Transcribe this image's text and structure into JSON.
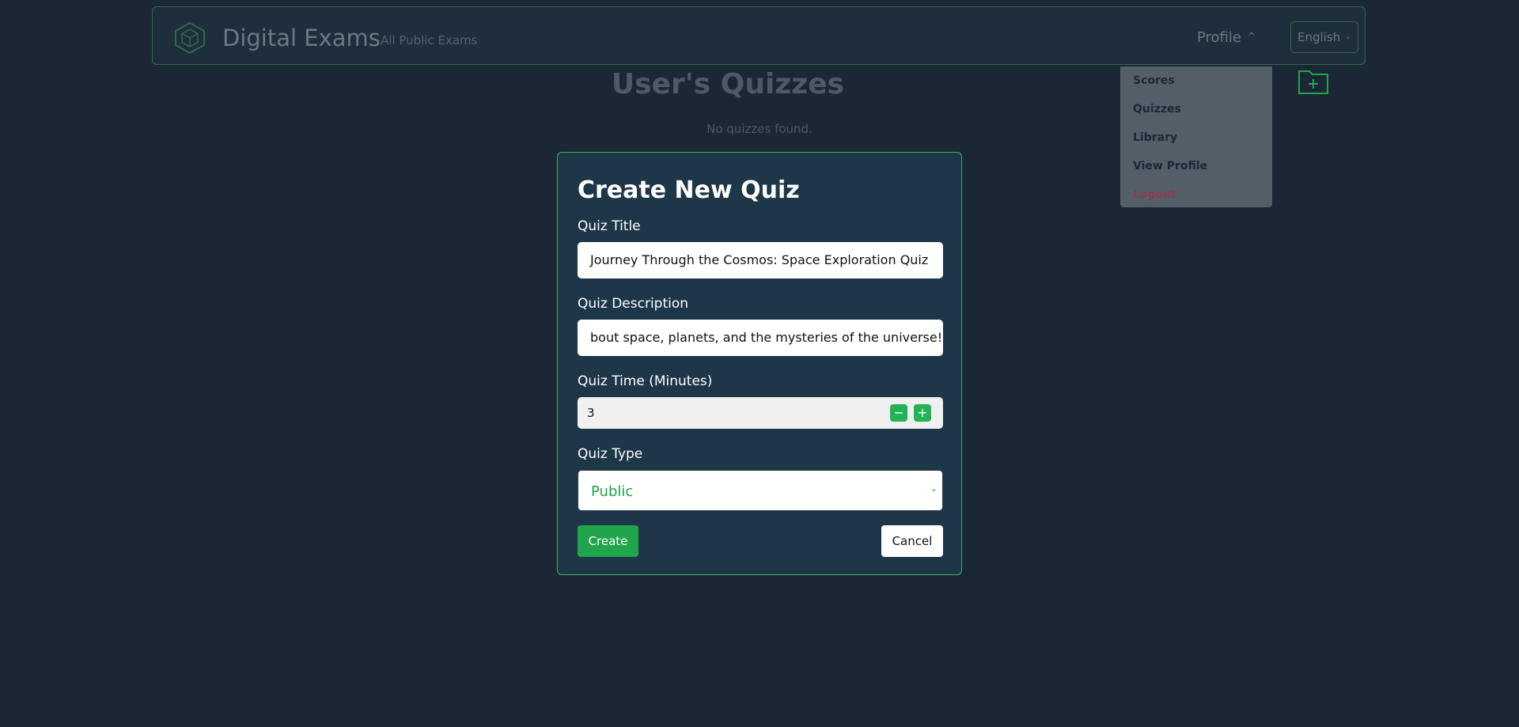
{
  "navbar": {
    "brand": "Digital Exams",
    "nav_link": "All Public Exams",
    "profile_label": "Profile",
    "language": "English"
  },
  "profile_menu": {
    "items": [
      "Scores",
      "Quizzes",
      "Library",
      "View Profile",
      "Logout"
    ]
  },
  "main": {
    "title": "User's Quizzes",
    "empty_message": "No quizzes found."
  },
  "modal": {
    "title": "Create New Quiz",
    "title_label": "Quiz Title",
    "title_value": "Journey Through the Cosmos: Space Exploration Quiz",
    "description_label": "Quiz Description",
    "description_value": "bout space, planets, and the mysteries of the universe!",
    "time_label": "Quiz Time (Minutes)",
    "time_value": "3",
    "type_label": "Quiz Type",
    "type_value": "Public",
    "create_label": "Create",
    "cancel_label": "Cancel"
  },
  "colors": {
    "background": "#1b2735",
    "modal_bg": "#1d3648",
    "accent_green": "#21a54c",
    "logout_red": "#8c3b4b"
  },
  "icons": [
    "cube-logo-icon",
    "chevron-up-icon",
    "chevron-down-icon",
    "folder-plus-icon",
    "minus-icon",
    "plus-icon"
  ]
}
